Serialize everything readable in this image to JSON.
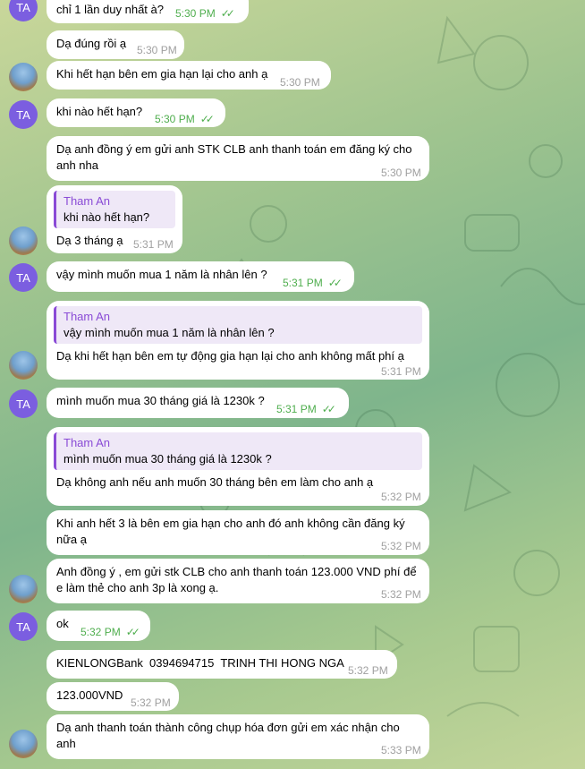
{
  "contact": {
    "initials": "TA",
    "name": "Tham An"
  },
  "messages": [
    {
      "text": "chỉ 1 lần duy nhất à?",
      "time": "5:30 PM"
    },
    {
      "text": "Dạ đúng rồi ạ",
      "time": "5:30 PM"
    },
    {
      "text": "Khi hết hạn bên em gia hạn lại cho anh ạ",
      "time": "5:30 PM"
    },
    {
      "text": "khi nào hết hạn?",
      "time": "5:30 PM"
    },
    {
      "text": "Dạ anh đồng ý em gửi anh STK CLB anh thanh toán em đăng ký cho\nanh nha",
      "time": "5:30 PM"
    },
    {
      "quote_name": "Tham An",
      "quote": "khi nào hết hạn?",
      "text": "Dạ 3 tháng ạ",
      "time": "5:31 PM"
    },
    {
      "text": "vậy mình muốn mua 1 năm là nhân lên ?",
      "time": "5:31 PM"
    },
    {
      "quote_name": "Tham An",
      "quote": "vậy mình muốn mua 1 năm là nhân lên ?",
      "text": "Dạ khi hết hạn bên em tự động gia hạn lại cho anh không mất phí ạ",
      "time": "5:31 PM"
    },
    {
      "text": "mình muốn mua 30 tháng giá là 1230k ?",
      "time": "5:31 PM"
    },
    {
      "quote_name": "Tham An",
      "quote": "mình muốn mua 30 tháng giá là 1230k ?",
      "text": "Dạ không anh nếu anh muốn 30 tháng bên em làm cho anh ạ",
      "time": "5:32 PM"
    },
    {
      "text": "Khi anh hết 3 là bên em gia hạn cho anh đó anh không cần đăng ký\nnữa ạ",
      "time": "5:32 PM"
    },
    {
      "text": "Anh đồng ý , em gửi stk CLB cho anh thanh toán 123.000 VND phí để\ne làm thẻ cho anh 3p là xong ạ.",
      "time": "5:32 PM"
    },
    {
      "text": "ok",
      "time": "5:32 PM"
    },
    {
      "text": "KIENLONGBank  0394694715  TRINH THI HONG NGA",
      "time": "5:32 PM"
    },
    {
      "text": "123.000VND",
      "time": "5:32 PM"
    },
    {
      "text": "Dạ anh thanh toán thành công chụp hóa đơn gửi em xác nhận cho\nanh",
      "time": "5:33 PM"
    }
  ],
  "read_check": "✓✓"
}
